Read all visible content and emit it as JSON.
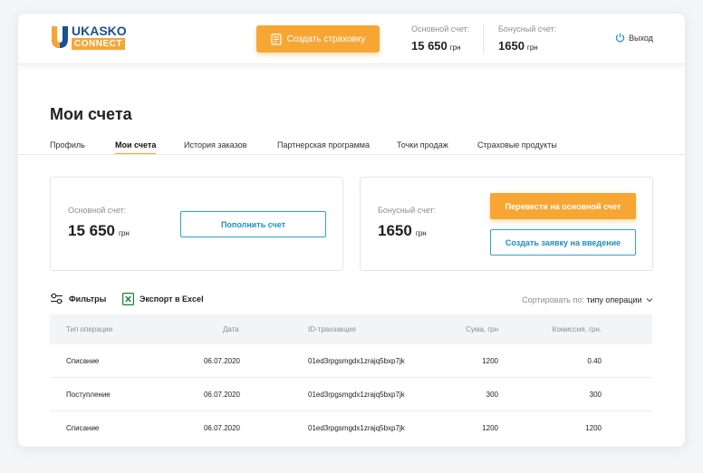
{
  "header": {
    "logo_top": "UKASKO",
    "logo_bottom": "CONNECT",
    "create_label": "Создать страховку",
    "main_account_label": "Основной счет:",
    "main_account_value": "15 650",
    "main_account_currency": "грн",
    "bonus_account_label": "Бонусный счет:",
    "bonus_account_value": "1650",
    "bonus_account_currency": "грн",
    "logout_label": "Выход"
  },
  "page": {
    "title": "Мои счета"
  },
  "tabs": [
    {
      "label": "Профиль",
      "active": false
    },
    {
      "label": "Мои счета",
      "active": true
    },
    {
      "label": "История заказов",
      "active": false
    },
    {
      "label": "Партнерская программа",
      "active": false
    },
    {
      "label": "Точки продаж",
      "active": false
    },
    {
      "label": "Страховые продукты",
      "active": false
    }
  ],
  "main_card": {
    "label": "Основной счет:",
    "value": "15 650",
    "currency": "грн",
    "button": "Пополнить счет"
  },
  "bonus_card": {
    "label": "Бонусный счет:",
    "value": "1650",
    "currency": "грн",
    "transfer_button": "Перевести на основной счет",
    "request_button": "Создать заявку на введение"
  },
  "toolbar": {
    "filters_label": "Фильтры",
    "export_label": "Экспорт в Excel",
    "sort_label": "Сортировать по:",
    "sort_value": "типу операции"
  },
  "table": {
    "columns": [
      "Тип операции",
      "Дата",
      "ID-транзакция",
      "Сума, грн",
      "Комиссия, грн."
    ],
    "rows": [
      [
        "Списание",
        "06.07.2020",
        "01ed3rpgsmgdx1zrajq5bxp7jk",
        "1200",
        "0.40"
      ],
      [
        "Поступление",
        "06.07.2020",
        "01ed3rpgsmgdx1zrajq5bxp7jk",
        "300",
        "300"
      ],
      [
        "Списание",
        "06.07.2020",
        "01ed3rpgsmgdx1zrajq5bxp7jk",
        "1200",
        "1200"
      ]
    ]
  },
  "colors": {
    "accent": "#f7a634",
    "brand_blue": "#1d4f91",
    "outline_blue": "#2aa3d8"
  },
  "icons": {
    "logo": "u-shape-logo-icon",
    "create": "document-icon",
    "logout": "power-icon",
    "filters": "sliders-icon",
    "export": "excel-icon",
    "sort": "chevron-down-icon"
  }
}
